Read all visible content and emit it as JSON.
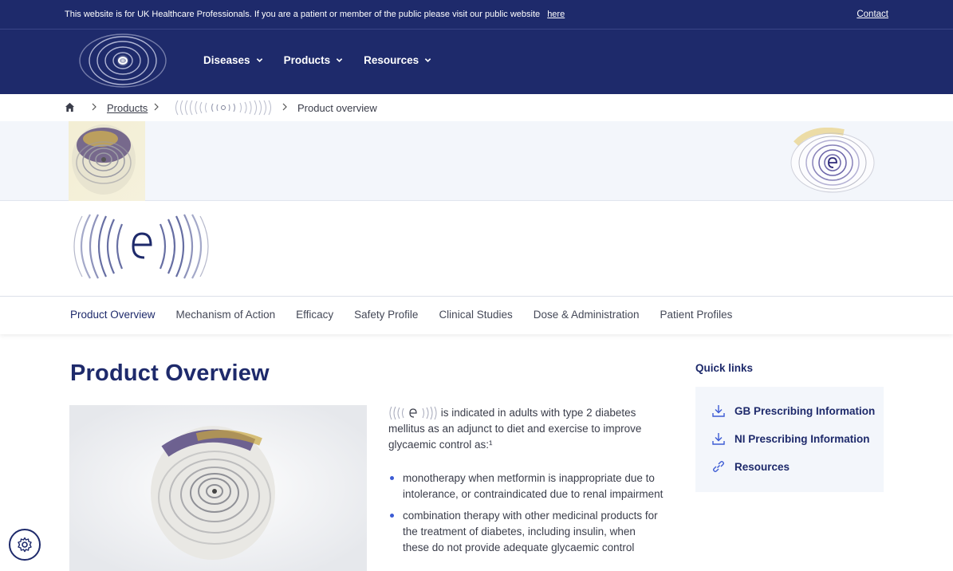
{
  "topbar": {
    "notice": "This website is for UK Healthcare Professionals. If you are a patient or member of the public please visit our public website",
    "notice_link": "here",
    "contact": "Contact"
  },
  "nav": {
    "items": [
      {
        "label": "Diseases",
        "icon": "chevron-down-icon"
      },
      {
        "label": "Products",
        "icon": "chevron-down-icon"
      },
      {
        "label": "Resources",
        "icon": "chevron-down-icon"
      }
    ]
  },
  "breadcrumb": {
    "home_icon": "home-icon",
    "products": "Products",
    "current": "Product overview"
  },
  "tabs": [
    "Product Overview",
    "Mechanism of Action",
    "Efficacy",
    "Safety Profile",
    "Clinical Studies",
    "Dose & Administration",
    "Patient Profiles"
  ],
  "main": {
    "title": "Product Overview",
    "intro": "is indicated in adults with type 2 diabetes mellitus as an adjunct to diet and exercise to improve glycaemic control as:¹",
    "bullets": [
      "monotherapy when metformin is inappropriate due to intolerance, or contraindicated due to renal impairment",
      "combination therapy with other medicinal products for the treatment of diabetes, including insulin, when these do not provide adequate glycaemic control"
    ]
  },
  "quick_links": {
    "title": "Quick links",
    "items": [
      {
        "label": "GB Prescribing Information",
        "icon": "download-icon"
      },
      {
        "label": "NI Prescribing Information",
        "icon": "download-icon"
      },
      {
        "label": "Resources",
        "icon": "link-icon"
      }
    ]
  },
  "colors": {
    "navy": "#1e2a6b",
    "accent_blue": "#3c5bd4",
    "light_bg": "#f3f6fb"
  },
  "cookie_button_icon": "gear-icon"
}
